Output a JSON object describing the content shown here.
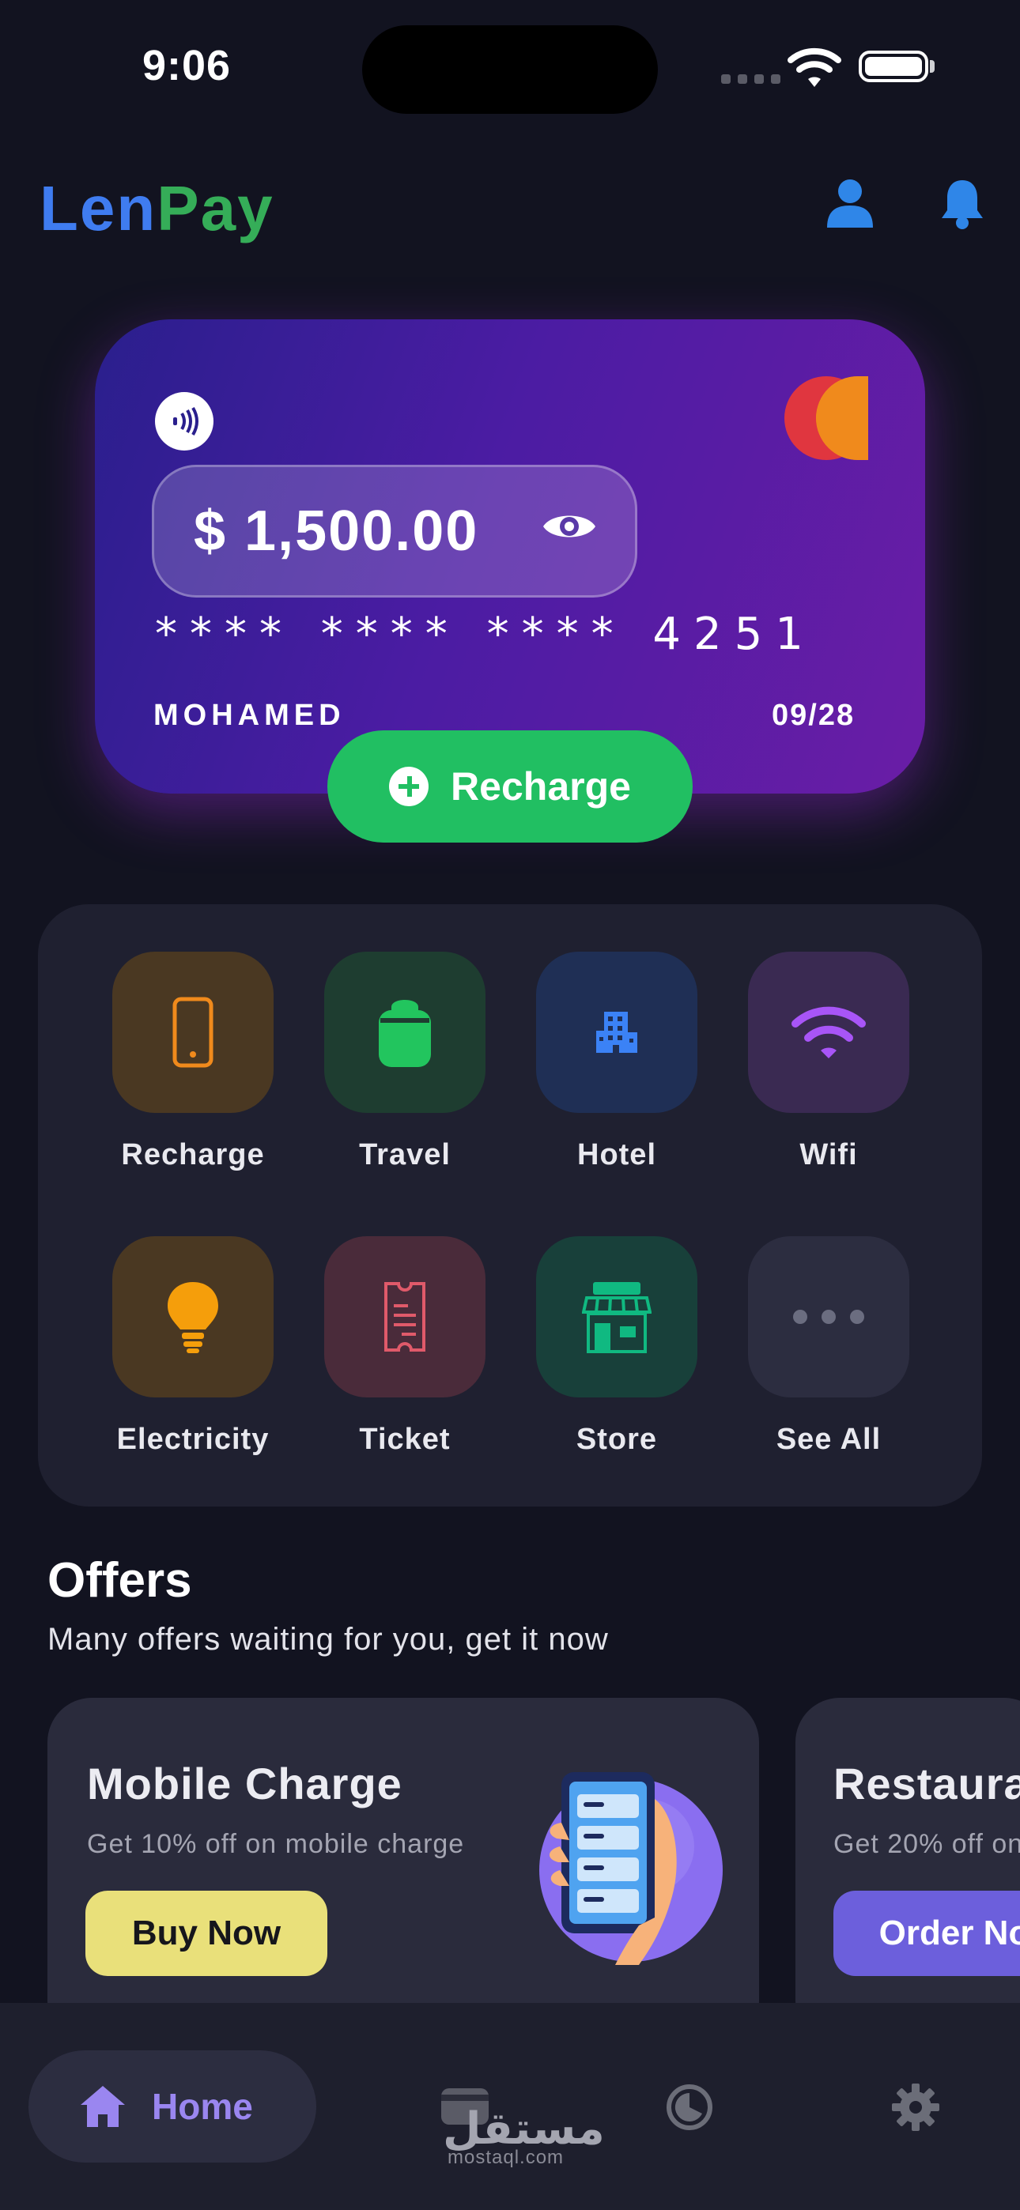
{
  "status_bar": {
    "time": "9:06"
  },
  "header": {
    "logo_part1": "Len",
    "logo_part2": "Pay",
    "icons": [
      "user-icon",
      "bell-icon"
    ]
  },
  "card": {
    "balance": "$ 1,500.00",
    "card_number": "**** **** **** 4251",
    "holder": "MOHAMED",
    "expiry": "09/28",
    "recharge_label": "Recharge"
  },
  "services": [
    {
      "label": "Recharge",
      "icon": "phone-icon",
      "color": "#f08a1c"
    },
    {
      "label": "Travel",
      "icon": "bag-icon",
      "color": "#22c55e"
    },
    {
      "label": "Hotel",
      "icon": "building-icon",
      "color": "#3b82f6"
    },
    {
      "label": "Wifi",
      "icon": "wifi-icon",
      "color": "#a855f7"
    },
    {
      "label": "Electricity",
      "icon": "bulb-icon",
      "color": "#f59e0b"
    },
    {
      "label": "Ticket",
      "icon": "ticket-icon",
      "color": "#e05a6a"
    },
    {
      "label": "Store",
      "icon": "store-icon",
      "color": "#10b981"
    },
    {
      "label": "See All",
      "icon": "more-icon",
      "color": "#6b6d80"
    }
  ],
  "offers": {
    "title": "Offers",
    "subtitle": "Many offers waiting for you, get it now",
    "items": [
      {
        "title": "Mobile Charge",
        "subtitle": "Get 10% off on mobile charge",
        "button": "Buy Now",
        "button_color": "#e9e07a"
      },
      {
        "title": "Restaura",
        "subtitle": "Get 20% off on",
        "button": "Order No",
        "button_color": "#6c5fdc"
      }
    ]
  },
  "nav": {
    "home_label": "Home",
    "watermark": "مستقل",
    "watermark_url": "mostaql.com"
  }
}
